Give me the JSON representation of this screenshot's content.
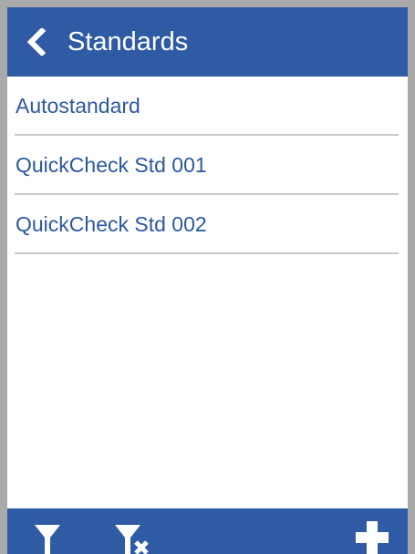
{
  "header": {
    "title": "Standards",
    "back_icon": "chevron-left-icon"
  },
  "list": {
    "items": [
      {
        "label": "Autostandard"
      },
      {
        "label": "QuickCheck Std 001"
      },
      {
        "label": "QuickCheck Std 002"
      }
    ]
  },
  "toolbar": {
    "filter_icon": "filter-icon",
    "clear_filter_icon": "filter-clear-icon",
    "add_icon": "plus-icon"
  },
  "colors": {
    "accent": "#2f5aa4",
    "item_text": "#2b58a0",
    "divider": "#c8c8c8",
    "frame": "#a9a9a9"
  }
}
